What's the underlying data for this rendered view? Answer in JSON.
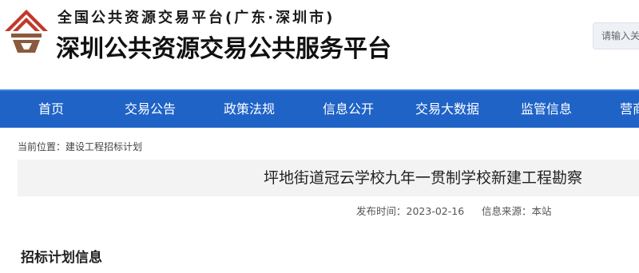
{
  "header": {
    "subtitle": "全国公共资源交易平台(广东·深圳市)",
    "title": "深圳公共资源交易公共服务平台",
    "search_placeholder": "请输入关"
  },
  "nav": {
    "items": [
      "首页",
      "交易公告",
      "政策法规",
      "信息公开",
      "交易大数据",
      "监管信息",
      "营商"
    ]
  },
  "breadcrumb": {
    "prefix": "当前位置：",
    "current": "建设工程招标计划"
  },
  "article": {
    "title": "坪地街道冠云学校九年一贯制学校新建工程勘察",
    "publish_time_label": "发布时间：",
    "publish_time": "2023-02-16",
    "source_label": "信息来源：",
    "source": "本站"
  },
  "section": {
    "heading": "招标计划信息"
  },
  "colors": {
    "nav_bg": "#1f63c7",
    "logo_red": "#c0392b",
    "logo_brown": "#8b5a3c"
  }
}
